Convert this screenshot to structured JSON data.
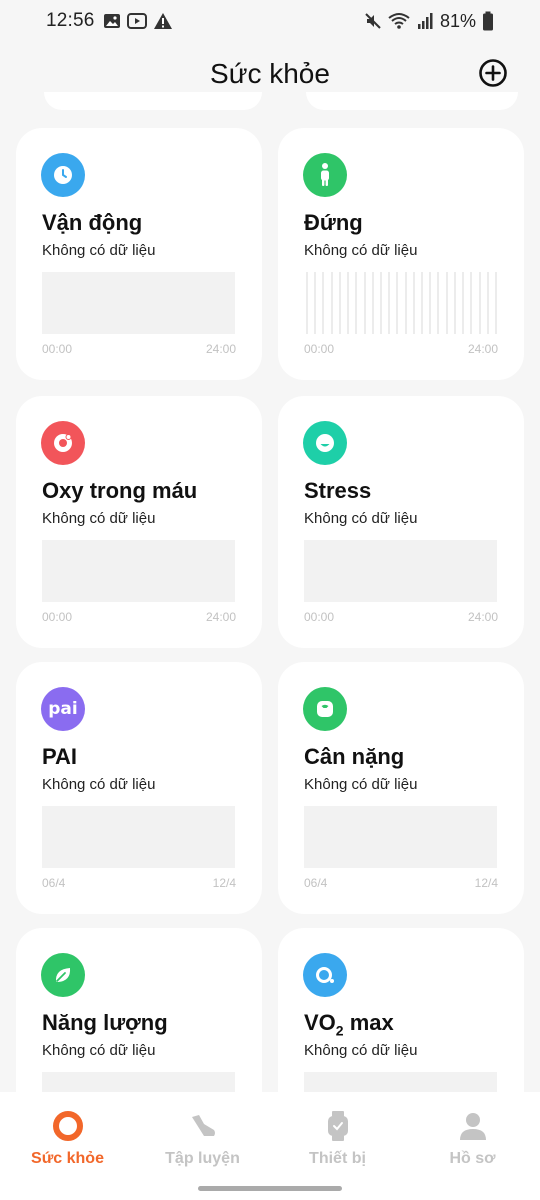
{
  "status_bar": {
    "time": "12:56",
    "battery_text": "81%",
    "left_icons": [
      "image-icon",
      "youtube-icon",
      "warning-icon"
    ],
    "right_icons": [
      "mute-icon",
      "wifi-icon",
      "signal-icon",
      "battery-icon"
    ]
  },
  "header": {
    "title": "Sức khỏe",
    "add_icon": "plus-circle-icon"
  },
  "colors": {
    "accent": "#f2672a",
    "blue": "#3aa8ee",
    "green": "#2fc568",
    "red": "#f2555a",
    "teal": "#1ecfa8",
    "purple": "#8a6cf0",
    "inactive": "#c4c4c4"
  },
  "cards": [
    {
      "title": "Vận động",
      "subtitle": "Không có dữ liệu",
      "axis_start": "00:00",
      "axis_end": "24:00",
      "icon": "clock-icon"
    },
    {
      "title": "Đứng",
      "subtitle": "Không có dữ liệu",
      "axis_start": "00:00",
      "axis_end": "24:00",
      "icon": "standing-person-icon"
    },
    {
      "title": "Oxy trong máu",
      "subtitle": "Không có dữ liệu",
      "axis_start": "00:00",
      "axis_end": "24:00",
      "icon": "blood-oxygen-icon"
    },
    {
      "title": "Stress",
      "subtitle": "Không có dữ liệu",
      "axis_start": "00:00",
      "axis_end": "24:00",
      "icon": "stress-face-icon"
    },
    {
      "title": "PAI",
      "subtitle": "Không có dữ liệu",
      "axis_start": "06/4",
      "axis_end": "12/4",
      "icon": "pai-icon",
      "icon_text": "pai"
    },
    {
      "title": "Cân nặng",
      "subtitle": "Không có dữ liệu",
      "axis_start": "06/4",
      "axis_end": "12/4",
      "icon": "scale-icon"
    },
    {
      "title": "Năng lượng",
      "subtitle": "Không có dữ liệu",
      "icon": "leaf-icon"
    },
    {
      "title_main": "VO",
      "title_sub": "2",
      "title_rest": " max",
      "subtitle": "Không có dữ liệu",
      "icon": "vo2-icon"
    }
  ],
  "nav": [
    {
      "label": "Sức khỏe",
      "icon": "health-ring-icon",
      "active": true
    },
    {
      "label": "Tập luyện",
      "icon": "shoe-icon",
      "active": false
    },
    {
      "label": "Thiết bị",
      "icon": "watch-icon",
      "active": false
    },
    {
      "label": "Hồ sơ",
      "icon": "profile-icon",
      "active": false
    }
  ]
}
